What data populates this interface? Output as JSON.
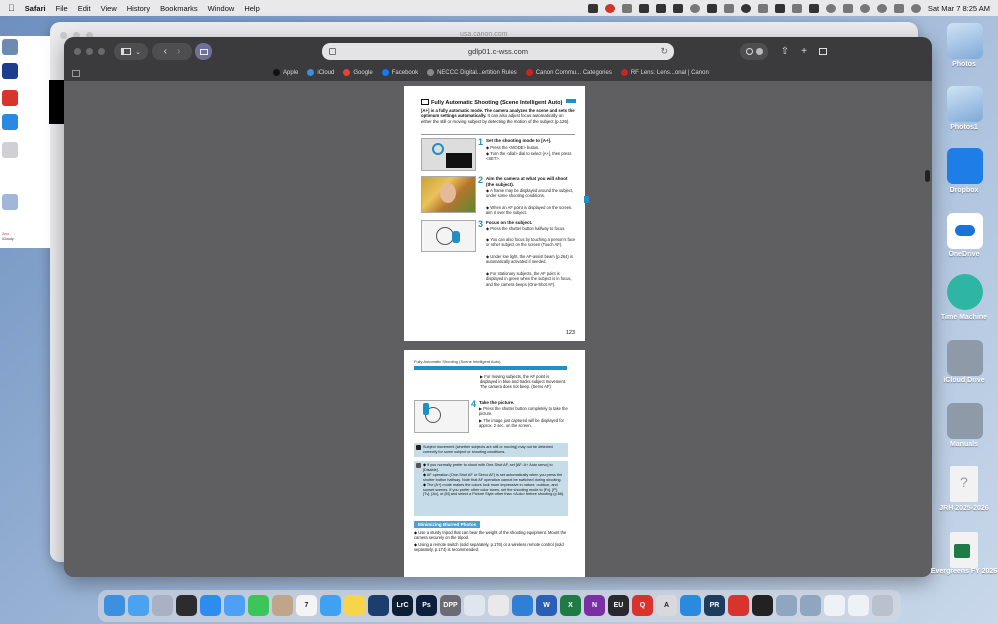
{
  "menubar": {
    "app_name": "Safari",
    "menus": [
      "File",
      "Edit",
      "View",
      "History",
      "Bookmarks",
      "Window",
      "Help"
    ],
    "clock": "Sat Mar 7  8:25 AM"
  },
  "background_window": {
    "url_ghost": "usa.canon.com"
  },
  "left_strip": {
    "items": [
      "Zero",
      "iCloudy"
    ]
  },
  "safari": {
    "url": "gdlp01.c-wss.com",
    "favorites": [
      {
        "label": "Apple",
        "color": "#111111"
      },
      {
        "label": "iCloud",
        "color": "#3a8ee6"
      },
      {
        "label": "Google",
        "color": "#e94235"
      },
      {
        "label": "Facebook",
        "color": "#1877f2"
      },
      {
        "label": "NECCC Digital...ertition Rules",
        "color": "#888888"
      },
      {
        "label": "Canon Commu... Categories",
        "color": "#cc2222"
      },
      {
        "label": "RF Lens: Lens...onal | Canon",
        "color": "#cc2222"
      }
    ]
  },
  "pdf": {
    "page1": {
      "title": "Fully Automatic Shooting (Scene Intelligent Auto)",
      "intro_bold": "[A+] is a fully automatic mode. The camera analyzes the scene and sets the optimum settings automatically.",
      "intro_rest": " It can also adjust focus automatically on either the still or moving subject by detecting the motion of the subject (p.126).",
      "steps": [
        {
          "num": "1",
          "title": "Set the shooting mode to [A+].",
          "bullets": [
            "Press the <MODE> button.",
            "Turn the <dial> dial to select [A+], then press <SET>."
          ]
        },
        {
          "num": "2",
          "title": "Aim the camera at what you will shoot (the subject).",
          "bullets": [
            "A frame may be displayed around the subject, under some shooting conditions.",
            "When an AF point is displayed on the screen, aim it over the subject."
          ]
        },
        {
          "num": "3",
          "title": "Focus on the subject.",
          "bullets": [
            "Press the shutter button halfway to focus.",
            "You can also focus by touching a person's face or other subject on the screen (Touch AF).",
            "Under low light, the AF-assist beam (p.264) is automatically activated if needed.",
            "For stationary subjects, the AF point is displayed in green when the subject is in focus, and the camera beeps (One-Shot AF)."
          ]
        }
      ],
      "page_number": "123"
    },
    "page2": {
      "header": "Fully Automatic Shooting (Scene Intelligent Auto)",
      "cont_bullet": "For moving subjects, the AF point is displayed in blue and tracks subject movement. The camera does not beep. (Servo AF)",
      "step4": {
        "num": "4",
        "title": "Take the picture.",
        "bullets": [
          "Press the shutter button completely to take the picture.",
          "The image just captured will be displayed for approx. 2 sec. on the screen."
        ]
      },
      "caution": "Subject movement (whether subjects are still or moving) may not be detected correctly for some subject or shooting conditions.",
      "notes": [
        "If you normally prefer to shoot with One-Shot AF, set [AF: A+ Auto servo] to [Disable].",
        "AF operation (One-Shot AF or Servo AF) is set automatically when you press the shutter button halfway. Note that AF operation cannot be switched during shooting.",
        "The [A+] mode makes the colors look more impressive in nature, outdoor, and sunset scenes. If you prefer other color tones, set the shooting mode to [Fv], [P], [Tv], [Av], or [M] and select a Picture Style other than <Auto> before shooting (p.66)."
      ],
      "section_title": "Minimizing Blurred Photos",
      "section_bullets": [
        "Use a sturdy tripod that can bear the weight of the shooting equipment. Mount the camera securely on the tripod.",
        "Using a remote switch (sold separately, p.176) or a wireless remote control (sold separately, p.174) is recommended."
      ]
    }
  },
  "desktop_icons": [
    "Photos",
    "Photos1",
    "Dropbox",
    "OneDrive",
    "Time Machine",
    "iCloud Drive",
    "Manuals",
    "JRH 2025-2026",
    "Evergreens FY 2026"
  ],
  "dock": {
    "apps": [
      {
        "name": "Finder",
        "color": "#3d8fe0",
        "label": ""
      },
      {
        "name": "iCloud",
        "color": "#4aa3f0",
        "label": ""
      },
      {
        "name": "Launchpad",
        "color": "#a9b2c4",
        "label": ""
      },
      {
        "name": "Mission Control",
        "color": "#2c2c2e",
        "label": ""
      },
      {
        "name": "App Store",
        "color": "#2d8cf0",
        "label": ""
      },
      {
        "name": "Mail",
        "color": "#4da0f5",
        "label": ""
      },
      {
        "name": "Messages",
        "color": "#3cc65a",
        "label": ""
      },
      {
        "name": "Contacts",
        "color": "#bfa68a",
        "label": ""
      },
      {
        "name": "Calendar",
        "color": "#f4f4f4",
        "label": "7"
      },
      {
        "name": "Safari",
        "color": "#3fa1f3",
        "label": ""
      },
      {
        "name": "Notes",
        "color": "#f7d54a",
        "label": ""
      },
      {
        "name": "Camera Connect",
        "color": "#1d3d6e",
        "label": ""
      },
      {
        "name": "Lightroom Classic",
        "color": "#0f1f33",
        "label": "LrC"
      },
      {
        "name": "Photoshop",
        "color": "#0e1f3e",
        "label": "Ps"
      },
      {
        "name": "Digital Photo Professional",
        "color": "#6b6b73",
        "label": "DPP"
      },
      {
        "name": "Preview",
        "color": "#dfe6ef",
        "label": ""
      },
      {
        "name": "Photos",
        "color": "#e9e9e9",
        "label": ""
      },
      {
        "name": "Bluetooth",
        "color": "#2f7fd6",
        "label": ""
      },
      {
        "name": "Word",
        "color": "#2b5fb5",
        "label": "W"
      },
      {
        "name": "Excel",
        "color": "#1e7b45",
        "label": "X"
      },
      {
        "name": "OneNote",
        "color": "#7a2fa3",
        "label": "N"
      },
      {
        "name": "EOS Utility",
        "color": "#2a2a2e",
        "label": "EU"
      },
      {
        "name": "Quicken",
        "color": "#d8332c",
        "label": "Q"
      },
      {
        "name": "Font Book",
        "color": "#d9d9dd",
        "label": "A"
      },
      {
        "name": "Windows App",
        "color": "#2a8ae0",
        "label": ""
      },
      {
        "name": "Picture Resize",
        "color": "#1e3d5c",
        "label": "PR"
      },
      {
        "name": "Toolbox",
        "color": "#d8332c",
        "label": ""
      },
      {
        "name": "Topaz",
        "color": "#222222",
        "label": ""
      },
      {
        "name": "Folder A",
        "color": "#8fa5c0",
        "label": ""
      },
      {
        "name": "Folder B",
        "color": "#8fa5c0",
        "label": ""
      },
      {
        "name": "Document",
        "color": "#eef2f7",
        "label": ""
      },
      {
        "name": "Document 2",
        "color": "#eef2f7",
        "label": ""
      },
      {
        "name": "Trash",
        "color": "#b9c1cc",
        "label": ""
      }
    ]
  }
}
